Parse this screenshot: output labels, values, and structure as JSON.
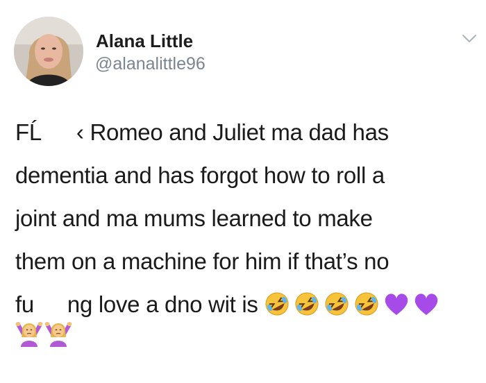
{
  "tweet": {
    "author": {
      "display_name": "Alana Little",
      "handle": "@alanalittle96"
    },
    "text": {
      "line1_start": "FĹ",
      "line1_mid": "‹",
      "line1_end": "Romeo and Juliet ma dad has",
      "line2": "dementia and has forgot how to roll a",
      "line3": "joint and ma mums learned to make",
      "line4": "them on a machine for him if that’s no",
      "line5_start": "fu",
      "line5_end": "ng love a dno wit is"
    },
    "emoji_icons": [
      "rofl-emoji",
      "rofl-emoji",
      "rofl-emoji",
      "rofl-emoji",
      "purple-heart-emoji",
      "purple-heart-emoji"
    ],
    "second_line_icons": [
      "person-shrugging-emoji",
      "person-shrugging-emoji"
    ]
  },
  "colors": {
    "text": "#1a1a1a",
    "handle": "#7b8590",
    "chevron": "#aab3bc",
    "purple_heart": "#a64be8",
    "emoji_yellow": "#f6c33a"
  }
}
